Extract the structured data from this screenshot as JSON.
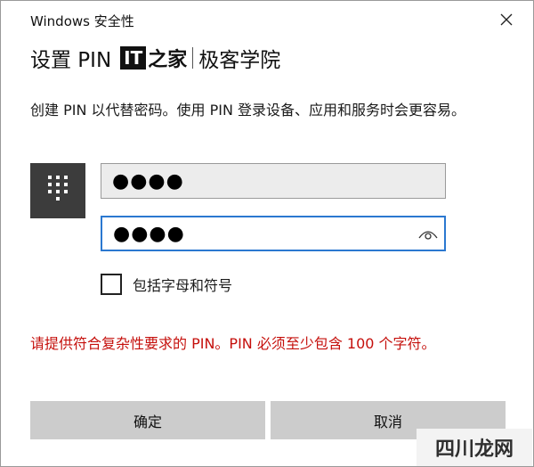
{
  "window": {
    "title": "Windows 安全性"
  },
  "header": {
    "title": "设置 PIN",
    "logo": {
      "it": "IT",
      "home": "之家",
      "sub": "极客学院"
    }
  },
  "description": "创建 PIN 以代替密码。使用 PIN 登录设备、应用和服务时会更容易。",
  "pin": {
    "field1_value": "●●●●",
    "field2_value": "●●●●"
  },
  "checkbox": {
    "label": "包括字母和符号",
    "checked": false
  },
  "error": "请提供符合复杂性要求的 PIN。PIN 必须至少包含 100 个字符。",
  "buttons": {
    "ok": "确定",
    "cancel": "取消"
  },
  "watermark": "四川龙网",
  "colors": {
    "error": "#c5100c",
    "focus_border": "#2b78d0",
    "button_bg": "#cccccc",
    "tile_bg": "#3c3c3c"
  },
  "icons": {
    "close": "close-icon",
    "keypad": "keypad-icon",
    "reveal": "eye-icon"
  }
}
